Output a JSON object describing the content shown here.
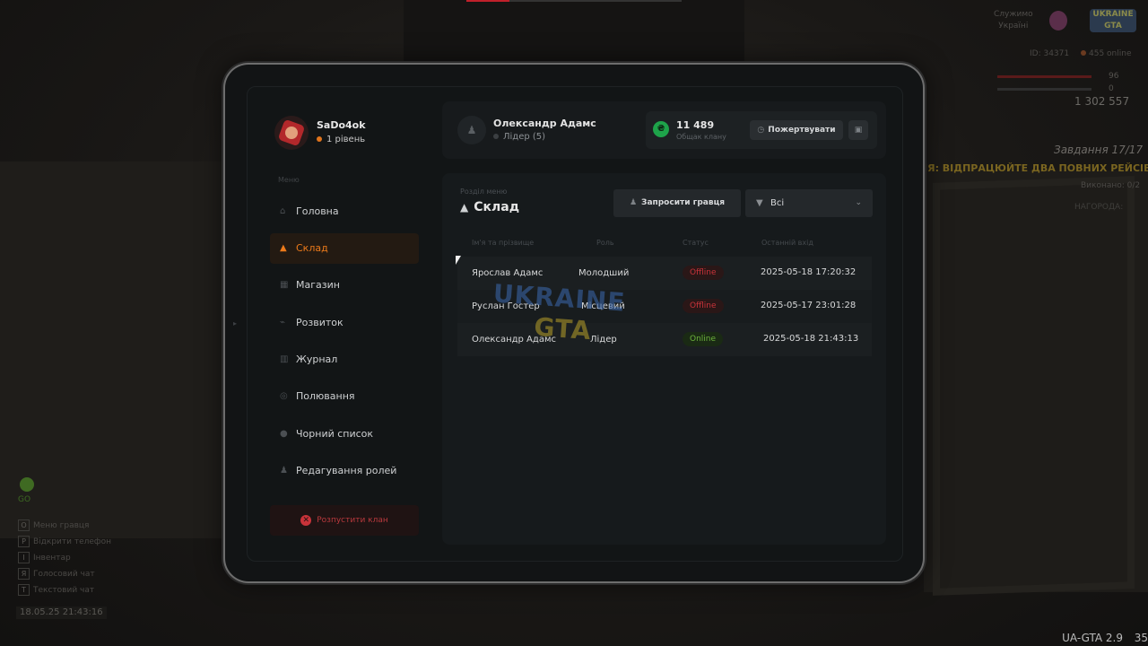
{
  "hud": {
    "brand_line1": "Служимо",
    "brand_line2": "Україні",
    "logo_line1": "UKRAINE",
    "logo_line2": "GTA",
    "player_id": "ID: 34371",
    "online": "455 online",
    "health": "96",
    "armor": "0",
    "money": "1 302 557",
    "task_title": "Завдання 17/17",
    "task_text": "ІЯ: ВІДПРАЦЮЙТЕ ДВА ПОВНИХ РЕЙСІВ.",
    "task_progress": "Виконано: 0/2",
    "task_reward": "НАГОРОДА:",
    "hotkeys": [
      {
        "key": "O",
        "label": "Меню гравця"
      },
      {
        "key": "P",
        "label": "Відкрити телефон"
      },
      {
        "key": "I",
        "label": "Інвентар"
      },
      {
        "key": "Я",
        "label": "Голосовий чат"
      },
      {
        "key": "T",
        "label": "Текстовий чат"
      }
    ],
    "radar_label": "GO",
    "datetime": "18.05.25 21:43:16",
    "version": "UA-GTA 2.9",
    "fps": "35"
  },
  "profile": {
    "name": "SaDo4ok",
    "level": "1 рівень"
  },
  "menu": {
    "caption": "Меню",
    "items": [
      {
        "label": "Головна",
        "icon": "home-icon",
        "glyph": "⌂"
      },
      {
        "label": "Склад",
        "icon": "warehouse-icon",
        "glyph": "▲"
      },
      {
        "label": "Магазин",
        "icon": "shop-icon",
        "glyph": "▦"
      },
      {
        "label": "Розвиток",
        "icon": "chart-icon",
        "glyph": "⌁"
      },
      {
        "label": "Журнал",
        "icon": "journal-icon",
        "glyph": "▥"
      },
      {
        "label": "Полювання",
        "icon": "target-icon",
        "glyph": "◎"
      },
      {
        "label": "Чорний список",
        "icon": "blacklist-icon",
        "glyph": "●"
      },
      {
        "label": "Редагування ролей",
        "icon": "user-edit-icon",
        "glyph": "♟"
      }
    ],
    "active_index": 1,
    "disband_label": "Розпустити клан"
  },
  "header": {
    "leader_name": "Олександр Адамс",
    "leader_role": "Лідер (5)",
    "bank_value": "11 489",
    "bank_label": "Общак клану",
    "donate_label": "Пожертвувати"
  },
  "section": {
    "caption": "Розділ меню",
    "title": "Склад",
    "invite_label": "Запросити гравця",
    "filter_value": "Всі",
    "columns": [
      "Ім'я та прізвище",
      "Роль",
      "Статус",
      "Останній вхід"
    ],
    "rows": [
      {
        "name": "Ярослав Адамс",
        "role": "Молодший",
        "status": "Offline",
        "last": "2025-05-18 17:20:32"
      },
      {
        "name": "Руслан Гостер",
        "role": "Місцевий",
        "status": "Offline",
        "last": "2025-05-17 23:01:28"
      },
      {
        "name": "Олександр Адамс",
        "role": "Лідер",
        "status": "Online",
        "last": "2025-05-18 21:43:13"
      }
    ]
  },
  "colors": {
    "accent": "#ec7a1a",
    "offline": "#c8333a",
    "online": "#6cb23c",
    "bank": "#1ea34a"
  }
}
